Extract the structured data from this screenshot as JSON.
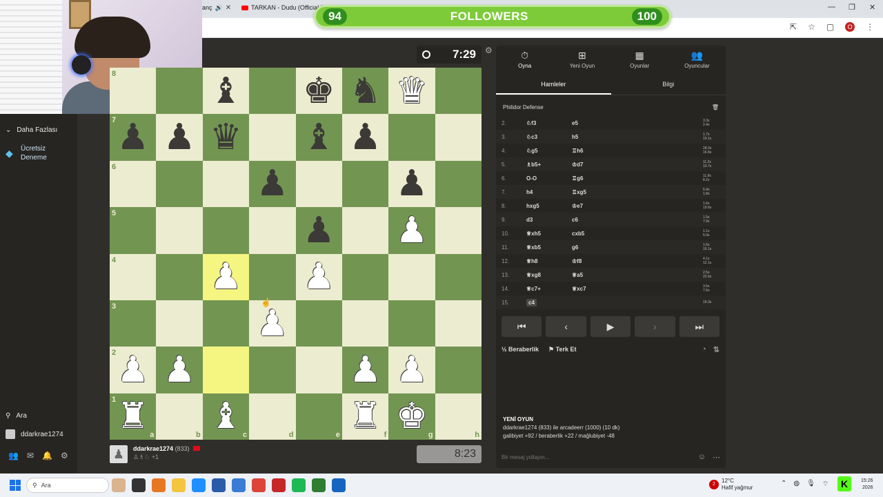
{
  "browser": {
    "tab_fragment": "anç",
    "tab_title": "TARKAN - Dudu (Official M",
    "profile_letter": "O"
  },
  "overlay": {
    "followers_current": "94",
    "followers_label": "FOLLOWERS",
    "followers_target": "100"
  },
  "sidebar": {
    "more_features": "Daha Fazlası",
    "free_trial_line1": "Ücretsiz",
    "free_trial_line2": "Deneme",
    "search": "Ara",
    "username": "ddarkrae1274"
  },
  "game": {
    "top_clock": "7:29",
    "bottom_clock": "8:23",
    "bottom_player": {
      "name": "ddarkrae1274",
      "rating": "(833)",
      "captures": "+1"
    },
    "board": {
      "ranks": [
        "8",
        "7",
        "6",
        "5",
        "4",
        "3",
        "2",
        "1"
      ],
      "files": [
        "a",
        "b",
        "c",
        "d",
        "e",
        "f",
        "g",
        "h"
      ],
      "highlight": [
        "c4",
        "c2"
      ],
      "position": {
        "c8": "bB",
        "e8": "bK",
        "f8": "bN",
        "g8": "wQ",
        "a7": "bP",
        "b7": "bP",
        "c7": "bQ",
        "e7": "bB",
        "f7": "bP",
        "d6": "bP",
        "g6": "bP",
        "e5": "bP",
        "g5": "wP",
        "c4": "wP",
        "e4": "wP",
        "d3": "wP",
        "a2": "wP",
        "b2": "wP",
        "f2": "wP",
        "g2": "wP",
        "a1": "wR",
        "c1": "wB",
        "f1": "wR",
        "g1": "wK"
      }
    }
  },
  "panel": {
    "nav": [
      {
        "label": "Oyna",
        "icon": "stopwatch-icon"
      },
      {
        "label": "Yeni Oyun",
        "icon": "plus-icon"
      },
      {
        "label": "Oyunlar",
        "icon": "board-icon"
      },
      {
        "label": "Oyuncular",
        "icon": "users-icon"
      }
    ],
    "tabs": [
      "Hamleler",
      "Bilgi"
    ],
    "opening": "Philidor Defense",
    "moves": [
      {
        "n": "2.",
        "w": "♘f3",
        "b": "e5",
        "tw": "3.3s",
        "tb": "2.4s"
      },
      {
        "n": "3.",
        "w": "♘c3",
        "b": "h5",
        "tw": "1.7s",
        "tb": "19.1s"
      },
      {
        "n": "4.",
        "w": "♘g5",
        "b": "♖h6",
        "tw": "28.0s",
        "tb": "16.8s"
      },
      {
        "n": "5.",
        "w": "♗b5+",
        "b": "♔d7",
        "tw": "11.2s",
        "tb": "10.7s"
      },
      {
        "n": "6.",
        "w": "O-O",
        "b": "♖g6",
        "tw": "11.8s",
        "tb": "8.2s"
      },
      {
        "n": "7.",
        "w": "h4",
        "b": "♖xg5",
        "tw": "5.4s",
        "tb": "1.8s"
      },
      {
        "n": "8.",
        "w": "hxg5",
        "b": "♔e7",
        "tw": "1.6s",
        "tb": "19.6s"
      },
      {
        "n": "9.",
        "w": "d3",
        "b": "c6",
        "tw": "1.5s",
        "tb": "7.9s"
      },
      {
        "n": "10.",
        "w": "♕xh5",
        "b": "cxb5",
        "tw": "1.1s",
        "tb": "5.0s"
      },
      {
        "n": "11.",
        "w": "♕xb5",
        "b": "g6",
        "tw": "1.6s",
        "tb": "16.1s"
      },
      {
        "n": "12.",
        "w": "♕h8",
        "b": "♔f8",
        "tw": "4.1s",
        "tb": "12.1s"
      },
      {
        "n": "13.",
        "w": "♕xg8",
        "b": "♕a5",
        "tw": "2.5s",
        "tb": "22.6s"
      },
      {
        "n": "14.",
        "w": "♕c7+",
        "b": "♕xc7",
        "tw": "3.5s",
        "tb": "7.6s"
      },
      {
        "n": "15.",
        "w": "c4",
        "b": "",
        "tw": "19.3s",
        "tb": ""
      }
    ],
    "draw": "Beraberlik",
    "resign": "Terk Et",
    "new_game_title": "YENİ OYUN",
    "new_game_line1": "ddarkrae1274 (833) ile arcadeerr (1000) (10 dk)",
    "new_game_line2": "galibiyet +92 / beraberlik +22 / mağlubiyet -48",
    "chat_placeholder": "Bir mesaj yollayın..."
  },
  "taskbar": {
    "search": "Ara",
    "weather_temp": "12°C",
    "weather_desc": "Hafif yağmur",
    "notif_count": "2",
    "clock_time": "15:26",
    "clock_date": "2026",
    "kick_badge": "K"
  },
  "colors": {
    "board_light": "#ececd0",
    "board_dark": "#739552",
    "highlight": "#f5f681",
    "followers_bar": "#7ecb3a"
  }
}
